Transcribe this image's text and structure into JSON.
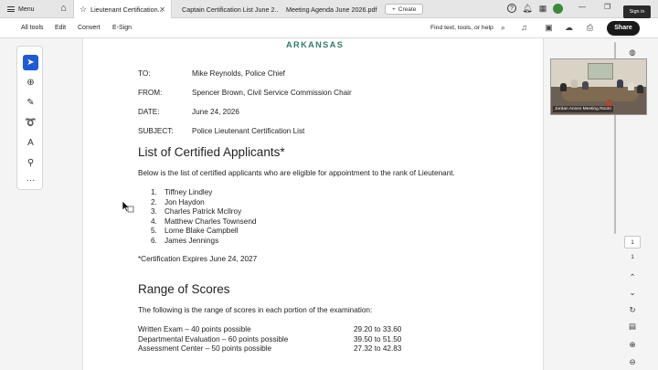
{
  "tabbar": {
    "menu_label": "Menu",
    "tabs": [
      {
        "label": "Lieutenant Certification...",
        "active": true
      },
      {
        "label": "Captain Certification List June 2...",
        "active": false
      },
      {
        "label": "Meeting Agenda June 2026.pdf",
        "active": false
      }
    ],
    "create_label": "Create",
    "signin_tooltip": "Sign in"
  },
  "toolbar": {
    "items": [
      "All tools",
      "Edit",
      "Convert",
      "E-Sign"
    ],
    "find_label": "Find text, tools, or help",
    "share_label": "Share"
  },
  "document": {
    "state_header": "ARKANSAS",
    "memo": {
      "to_key": "TO:",
      "to_val": "Mike Reynolds, Police Chief",
      "from_key": "FROM:",
      "from_val": "Spencer Brown, Civil Service Commission Chair",
      "date_key": "DATE:",
      "date_val": "June 24, 2026",
      "subject_key": "SUBJECT:",
      "subject_val": "Police Lieutenant Certification List"
    },
    "heading1": "List of Certified Applicants*",
    "intro": "Below is the list of certified applicants who are eligible for appointment to the rank of Lieutenant.",
    "applicants": [
      {
        "num": "1.",
        "name": "Tiffney Lindley"
      },
      {
        "num": "2.",
        "name": "Jon Haydon"
      },
      {
        "num": "3.",
        "name": "Charles Patrick McIlroy"
      },
      {
        "num": "4.",
        "name": "Matthew Charles Townsend"
      },
      {
        "num": "5.",
        "name": "Lorne Blake Campbell"
      },
      {
        "num": "6.",
        "name": "James Jennings"
      }
    ],
    "expires": "*Certification Expires June 24, 2027",
    "heading2": "Range of Scores",
    "range_intro": "The following is the range of scores in each portion of the examination:",
    "scores": [
      {
        "label": "Written Exam – 40 points possible",
        "range": "29.20 to 33.60"
      },
      {
        "label": "Departmental Evaluation – 60 points possible",
        "range": "39.50 to 51.50"
      },
      {
        "label": "Assessment Center – 50 points possible",
        "range": "27.32 to 42.83"
      }
    ]
  },
  "video": {
    "label": "Jordan Annex Meeting Room"
  },
  "rightrail": {
    "page_current": "1",
    "page_total": "1"
  },
  "icons": {
    "home": "home-icon",
    "search": "search-icon",
    "help": "help-icon",
    "bell": "bell-icon",
    "apps": "apps-icon"
  },
  "colors": {
    "accent": "#1f5bd6",
    "state_header": "#2e7d69",
    "share_bg": "#1a1a1a"
  }
}
